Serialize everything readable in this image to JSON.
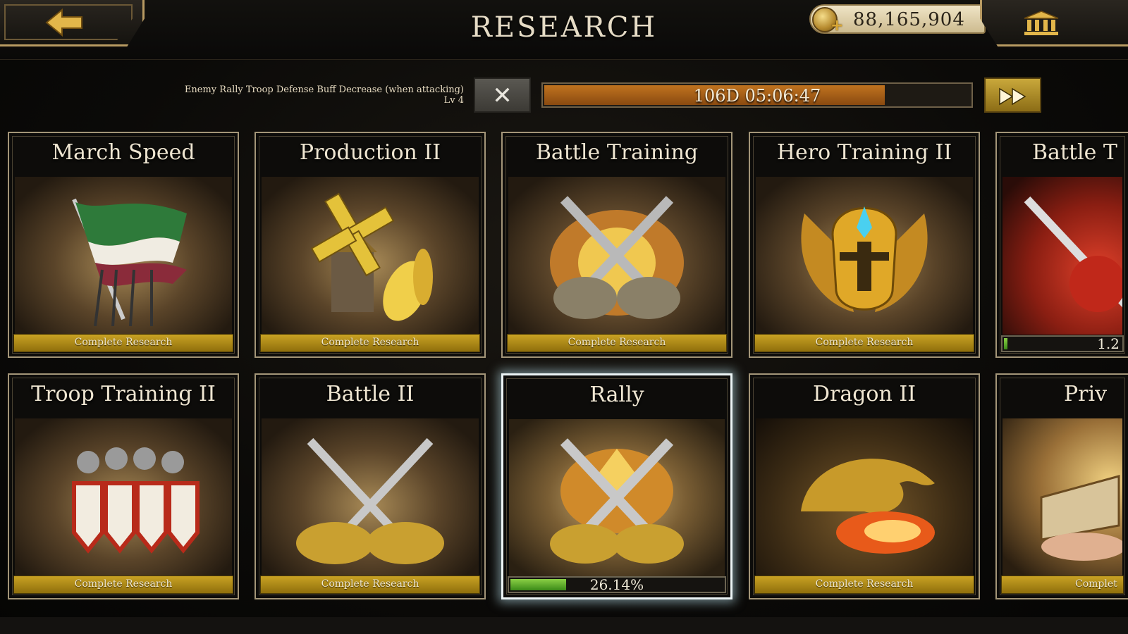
{
  "header": {
    "title": "RESEARCH",
    "gold_amount": "88,165,904",
    "back_icon": "back-arrow-icon",
    "bank_icon": "bank-icon",
    "coin_icon": "gold-coin-icon"
  },
  "current_research": {
    "description": "Enemy Rally Troop Defense Buff Decrease (when attacking) Lv 4",
    "timer": "106D 05:06:47",
    "progress_fraction": 0.8,
    "cancel_label": "✕"
  },
  "cards": [
    {
      "name": "March Speed",
      "action": "Complete Research",
      "icon": "flag-spears-icon"
    },
    {
      "name": "Production II",
      "action": "Complete Research",
      "icon": "windmill-wheat-icon"
    },
    {
      "name": "Battle Training",
      "action": "Complete Research",
      "icon": "crossed-swords-crest-icon"
    },
    {
      "name": "Hero Training II",
      "action": "Complete Research",
      "icon": "golden-helmet-icon"
    },
    {
      "name": "Battle T",
      "progress_text": "1.2",
      "progress_fraction": 0.03,
      "icon": "red-swords-icon"
    },
    {
      "name": "Troop Training II",
      "action": "Complete Research",
      "icon": "knights-shields-icon"
    },
    {
      "name": "Battle II",
      "action": "Complete Research",
      "icon": "crossed-swords-gauntlets-icon"
    },
    {
      "name": "Rally",
      "progress_text": "26.14%",
      "progress_fraction": 0.2614,
      "icon": "rally-crest-icon"
    },
    {
      "name": "Dragon II",
      "action": "Complete Research",
      "icon": "dragon-fire-icon"
    },
    {
      "name": "Priv",
      "action": "Complet",
      "icon": "book-hand-icon"
    }
  ],
  "colors": {
    "accent_gold": "#b89a62",
    "button_gold": "#c9a224",
    "progress_orange": "#c0731f",
    "progress_green": "#8bd045"
  }
}
